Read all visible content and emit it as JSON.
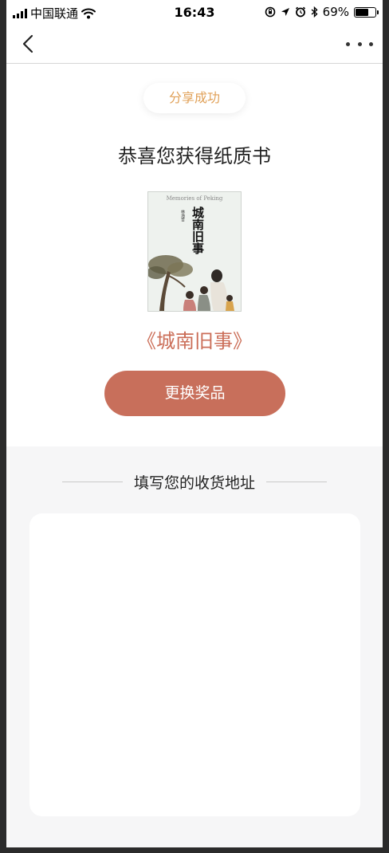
{
  "status_bar": {
    "carrier": "中国联通",
    "time": "16:43",
    "battery_percent": "69%",
    "battery_level": 0.69,
    "icons": [
      "signal-icon",
      "wifi-icon",
      "orientation-lock-icon",
      "location-arrow-icon",
      "alarm-icon",
      "bluetooth-icon",
      "battery-icon"
    ]
  },
  "nav": {
    "back_icon": "chevron-left-icon",
    "more_icon": "more-dots-icon"
  },
  "result": {
    "badge": "分享成功",
    "headline": "恭喜您获得纸质书",
    "book_title": "《城南旧事》",
    "swap_button": "更换奖品"
  },
  "book_cover": {
    "title": "城南旧事",
    "english_title": "Memories of Peking",
    "author": "林海音"
  },
  "address": {
    "section_title": "填写您的收货地址"
  },
  "colors": {
    "accent": "#c86f5b",
    "book_title": "#cb6e58",
    "badge_text": "#e0a057",
    "page_background": "#f6f6f7"
  }
}
